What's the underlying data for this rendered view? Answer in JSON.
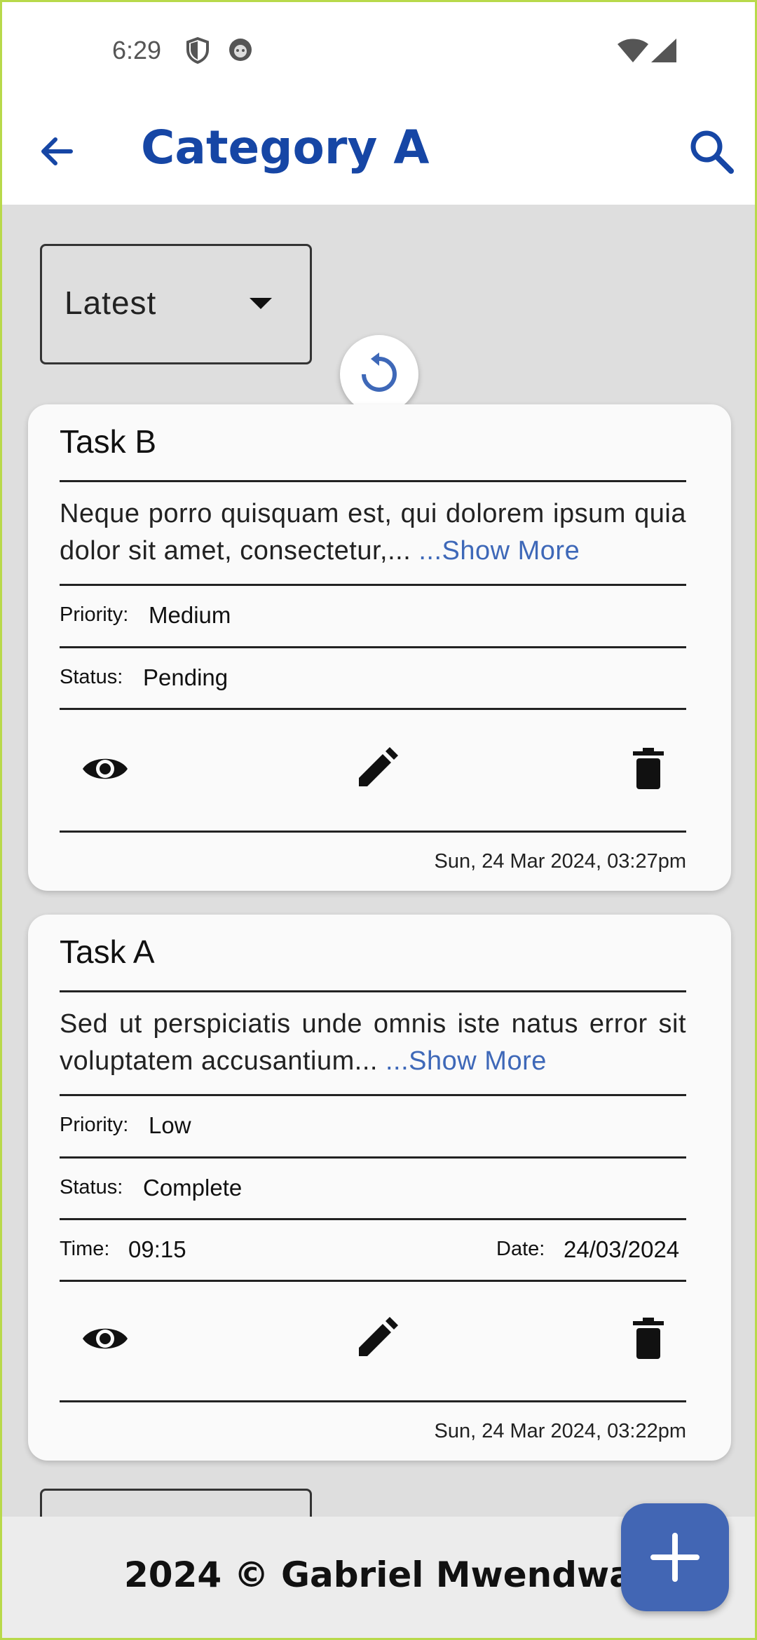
{
  "status_bar": {
    "time": "6:29"
  },
  "app_bar": {
    "title": "Category A"
  },
  "sort": {
    "selected": "Latest"
  },
  "tasks": [
    {
      "title": "Task B",
      "description": "Neque porro quisquam est, qui dolorem ipsum quia dolor sit amet, consectetur,...",
      "show_more": "...Show More",
      "priority_label": "Priority:",
      "priority": "Medium",
      "status_label": "Status:",
      "status": "Pending",
      "timestamp": "Sun, 24 Mar 2024, 03:27pm"
    },
    {
      "title": "Task A",
      "description": "Sed ut perspiciatis unde omnis iste natus error sit voluptatem accusantium...",
      "show_more": "...Show More",
      "priority_label": "Priority:",
      "priority": "Low",
      "status_label": "Status:",
      "status": "Complete",
      "time_label": "Time:",
      "time": "09:15",
      "date_label": "Date:",
      "date": "24/03/2024",
      "timestamp": "Sun, 24 Mar 2024, 03:22pm"
    }
  ],
  "footer": {
    "text": "2024 © Gabriel Mwendwa"
  },
  "colors": {
    "accent": "#1646a5",
    "fab": "#4266b4",
    "link": "#3e68b8"
  }
}
